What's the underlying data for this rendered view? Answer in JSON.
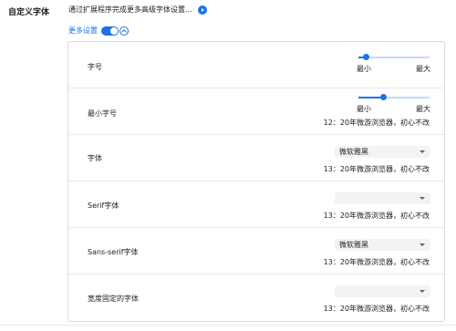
{
  "section": {
    "title": "自定义字体",
    "ext_text": "通过扩展程序完成更多高级字体设置...",
    "more_label": "更多设置"
  },
  "controls": {
    "toggle_on": true
  },
  "rows": {
    "font_size": {
      "label": "字号",
      "min": "最小",
      "max": "最大",
      "level": 0.1
    },
    "min_font_size": {
      "label": "最小字号",
      "min": "最小",
      "max": "最大",
      "level": 0.35,
      "preview": "12：20年微游浏览器，初心不改"
    },
    "standard": {
      "label": "字体",
      "value": "微软雅黑",
      "preview": "13：20年微游浏览器，初心不改"
    },
    "serif": {
      "label": "Serif字体",
      "value": "",
      "preview": "13：20年微游浏览器，初心不改"
    },
    "sans": {
      "label": "Sans-serif字体",
      "value": "微软雅黑",
      "preview": "13：20年微游浏览器，初心不改"
    },
    "fixed": {
      "label": "宽度固定的字体",
      "value": "",
      "preview": "13：20年微游浏览器，初心不改"
    }
  },
  "colors": {
    "accent": "#1a73e8",
    "track": "#c6dafc",
    "select_bg": "#f1f3f4"
  },
  "icons": {
    "ext": "play-icon",
    "collapse": "chevron-up-icon",
    "dropdown": "caret-down-icon"
  }
}
